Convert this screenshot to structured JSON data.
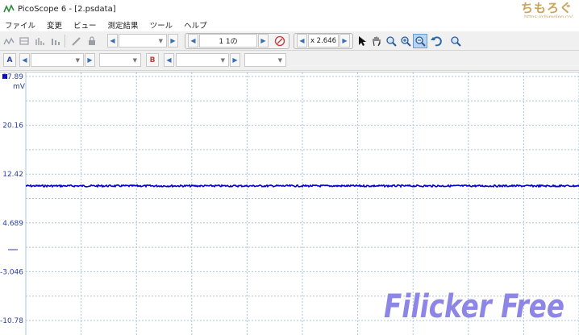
{
  "window": {
    "title": "PicoScope 6 - [2.psdata]"
  },
  "watermark": {
    "logo_text": "ちもろぐ",
    "logo_url": "https://chimolog.co/"
  },
  "menu": {
    "items": [
      "ファイル",
      "変更",
      "ビュー",
      "測定結果",
      "ツール",
      "ヘルプ"
    ]
  },
  "toolbar1": {
    "capture_count": "1 1の",
    "zoom_value": "x 2.646"
  },
  "toolbar2": {
    "channel_a_label": "A",
    "channel_b_label": "B"
  },
  "colors": {
    "trace": "#0000cc",
    "axis_text": "#2a3f9e",
    "grid": "#a9c6d6",
    "watermark": "#8e86e6"
  },
  "chart_data": {
    "type": "line",
    "y_unit": "mV",
    "y_tick_labels": [
      "27.89",
      "20.16",
      "12.42",
      "4.689",
      "-3.046",
      "-10.78"
    ],
    "ylim": [
      -10.78,
      27.89
    ],
    "series": [
      {
        "values": [
          10.55
        ]
      }
    ],
    "grid": true,
    "annotation": "Filicker Free"
  }
}
